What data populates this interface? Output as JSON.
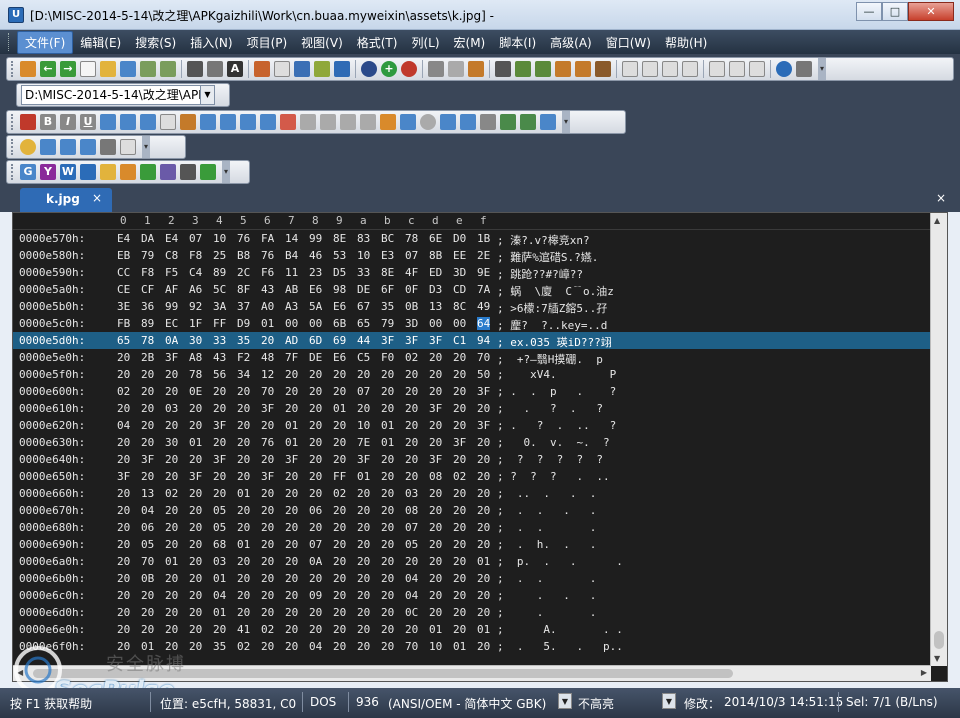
{
  "titlebar": {
    "title": "[D:\\MISC-2014-5-14\\改之理\\APKgaizhili\\Work\\cn.buaa.myweixin\\assets\\k.jpg] -",
    "minimize": "—",
    "maximize": "□",
    "close": "✕"
  },
  "menu": [
    "文件(F)",
    "编辑(E)",
    "搜索(S)",
    "插入(N)",
    "项目(P)",
    "视图(V)",
    "格式(T)",
    "列(L)",
    "宏(M)",
    "脚本(I)",
    "高级(A)",
    "窗口(W)",
    "帮助(H)"
  ],
  "path_combo": "D:\\MISC-2014-5-14\\改之理\\APK",
  "tab": {
    "label": "k.jpg",
    "close": "×"
  },
  "ruler": [
    "0",
    "1",
    "2",
    "3",
    "4",
    "5",
    "6",
    "7",
    "8",
    "9",
    "a",
    "b",
    "c",
    "d",
    "e",
    "f"
  ],
  "rows": [
    {
      "addr": "0000e570h:",
      "hex": [
        "E4",
        "DA",
        "E4",
        "07",
        "10",
        "76",
        "FA",
        "14",
        "99",
        "8E",
        "83",
        "BC",
        "78",
        "6E",
        "D0",
        "1B"
      ],
      "ascii": "; 溱?.v?槔竞xn?"
    },
    {
      "addr": "0000e580h:",
      "hex": [
        "EB",
        "79",
        "C8",
        "F8",
        "25",
        "B8",
        "76",
        "B4",
        "46",
        "53",
        "10",
        "E3",
        "07",
        "8B",
        "EE",
        "2E"
      ],
      "ascii": "; 難萨%逭碏S.?嬿."
    },
    {
      "addr": "0000e590h:",
      "hex": [
        "CC",
        "F8",
        "F5",
        "C4",
        "89",
        "2C",
        "F6",
        "11",
        "23",
        "D5",
        "33",
        "8E",
        "4F",
        "ED",
        "3D",
        "9E"
      ],
      "ascii": "; 跳跄??#?嶂??"
    },
    {
      "addr": "0000e5a0h:",
      "hex": [
        "CE",
        "CF",
        "AF",
        "A6",
        "5C",
        "8F",
        "43",
        "AB",
        "E6",
        "98",
        "DE",
        "6F",
        "0F",
        "D3",
        "CD",
        "7A"
      ],
      "ascii": "; 蜗  \\廈  C﹊o.油z"
    },
    {
      "addr": "0000e5b0h:",
      "hex": [
        "3E",
        "36",
        "99",
        "92",
        "3A",
        "37",
        "A0",
        "A3",
        "5A",
        "E6",
        "67",
        "35",
        "0B",
        "13",
        "8C",
        "49"
      ],
      "ascii": "; >6檬:7牐Z鎔5..孖"
    },
    {
      "addr": "0000e5c0h:",
      "hex": [
        "FB",
        "89",
        "EC",
        "1F",
        "FF",
        "D9",
        "01",
        "00",
        "00",
        "6B",
        "65",
        "79",
        "3D",
        "00",
        "00",
        "64"
      ],
      "ascii": "; 麈?  ?..key=..d"
    },
    {
      "addr": "0000e5d0h:",
      "hex": [
        "65",
        "78",
        "0A",
        "30",
        "33",
        "35",
        "20",
        "AD",
        "6D",
        "69",
        "44",
        "3F",
        "3F",
        "3F",
        "C1",
        "94"
      ],
      "ascii": "; ex.035 瑛iD???翊"
    },
    {
      "addr": "0000e5e0h:",
      "hex": [
        "20",
        "2B",
        "3F",
        "A8",
        "43",
        "F2",
        "48",
        "7F",
        "DE",
        "E6",
        "C5",
        "F0",
        "02",
        "20",
        "20",
        "70"
      ],
      "ascii": ";  +?―翳H摸硼.  p"
    },
    {
      "addr": "0000e5f0h:",
      "hex": [
        "20",
        "20",
        "20",
        "78",
        "56",
        "34",
        "12",
        "20",
        "20",
        "20",
        "20",
        "20",
        "20",
        "20",
        "20",
        "50"
      ],
      "ascii": ";    xV4.        P"
    },
    {
      "addr": "0000e600h:",
      "hex": [
        "02",
        "20",
        "20",
        "0E",
        "20",
        "20",
        "70",
        "20",
        "20",
        "20",
        "07",
        "20",
        "20",
        "20",
        "20",
        "3F"
      ],
      "ascii": "; .  .  p   .    ?"
    },
    {
      "addr": "0000e610h:",
      "hex": [
        "20",
        "20",
        "03",
        "20",
        "20",
        "20",
        "3F",
        "20",
        "20",
        "01",
        "20",
        "20",
        "20",
        "3F",
        "20",
        "20"
      ],
      "ascii": ";   .   ?  .   ?"
    },
    {
      "addr": "0000e620h:",
      "hex": [
        "04",
        "20",
        "20",
        "20",
        "3F",
        "20",
        "20",
        "01",
        "20",
        "20",
        "10",
        "01",
        "20",
        "20",
        "20",
        "3F"
      ],
      "ascii": "; .   ?  .  ..   ?"
    },
    {
      "addr": "0000e630h:",
      "hex": [
        "20",
        "20",
        "30",
        "01",
        "20",
        "20",
        "76",
        "01",
        "20",
        "20",
        "7E",
        "01",
        "20",
        "20",
        "3F",
        "20"
      ],
      "ascii": ";   0.  v.  ~.  ?"
    },
    {
      "addr": "0000e640h:",
      "hex": [
        "20",
        "3F",
        "20",
        "20",
        "3F",
        "20",
        "20",
        "3F",
        "20",
        "20",
        "3F",
        "20",
        "20",
        "3F",
        "20",
        "20"
      ],
      "ascii": ";  ?  ?  ?  ?  ?"
    },
    {
      "addr": "0000e650h:",
      "hex": [
        "3F",
        "20",
        "20",
        "3F",
        "20",
        "20",
        "3F",
        "20",
        "20",
        "FF",
        "01",
        "20",
        "20",
        "08",
        "02",
        "20"
      ],
      "ascii": "; ?  ?  ?   .  .."
    },
    {
      "addr": "0000e660h:",
      "hex": [
        "20",
        "13",
        "02",
        "20",
        "20",
        "01",
        "20",
        "20",
        "20",
        "02",
        "20",
        "20",
        "03",
        "20",
        "20",
        "20"
      ],
      "ascii": ";  ..  .   .  ."
    },
    {
      "addr": "0000e670h:",
      "hex": [
        "20",
        "04",
        "20",
        "20",
        "05",
        "20",
        "20",
        "20",
        "06",
        "20",
        "20",
        "20",
        "08",
        "20",
        "20",
        "20"
      ],
      "ascii": ";  .  .   .   ."
    },
    {
      "addr": "0000e680h:",
      "hex": [
        "20",
        "06",
        "20",
        "20",
        "05",
        "20",
        "20",
        "20",
        "20",
        "20",
        "20",
        "20",
        "07",
        "20",
        "20",
        "20"
      ],
      "ascii": ";  .  .       ."
    },
    {
      "addr": "0000e690h:",
      "hex": [
        "20",
        "05",
        "20",
        "20",
        "68",
        "01",
        "20",
        "20",
        "07",
        "20",
        "20",
        "20",
        "05",
        "20",
        "20",
        "20"
      ],
      "ascii": ";  .  h.  .   ."
    },
    {
      "addr": "0000e6a0h:",
      "hex": [
        "20",
        "70",
        "01",
        "20",
        "03",
        "20",
        "20",
        "20",
        "0A",
        "20",
        "20",
        "20",
        "20",
        "20",
        "20",
        "01"
      ],
      "ascii": ";  p.  .   .      ."
    },
    {
      "addr": "0000e6b0h:",
      "hex": [
        "20",
        "0B",
        "20",
        "20",
        "01",
        "20",
        "20",
        "20",
        "20",
        "20",
        "20",
        "20",
        "04",
        "20",
        "20",
        "20"
      ],
      "ascii": ";  .  .       ."
    },
    {
      "addr": "0000e6c0h:",
      "hex": [
        "20",
        "20",
        "20",
        "20",
        "04",
        "20",
        "20",
        "20",
        "09",
        "20",
        "20",
        "20",
        "04",
        "20",
        "20",
        "20"
      ],
      "ascii": ";     .   .   ."
    },
    {
      "addr": "0000e6d0h:",
      "hex": [
        "20",
        "20",
        "20",
        "20",
        "01",
        "20",
        "20",
        "20",
        "20",
        "20",
        "20",
        "20",
        "0C",
        "20",
        "20",
        "20"
      ],
      "ascii": ";     .       ."
    },
    {
      "addr": "0000e6e0h:",
      "hex": [
        "20",
        "20",
        "20",
        "20",
        "20",
        "41",
        "02",
        "20",
        "20",
        "20",
        "20",
        "20",
        "20",
        "01",
        "20",
        "01"
      ],
      "ascii": ";      A.       . ."
    },
    {
      "addr": "0000e6f0h:",
      "hex": [
        "20",
        "01",
        "20",
        "20",
        "35",
        "02",
        "20",
        "20",
        "04",
        "20",
        "20",
        "20",
        "70",
        "10",
        "01",
        "20"
      ],
      "ascii": ";  .   5.   .   p.."
    }
  ],
  "status": {
    "help": "按 F1 获取帮助",
    "position": "位置: e5cfH, 58831, C0",
    "line_ending": "DOS",
    "codepage": "936",
    "encoding": "(ANSI/OEM - 简体中文 GBK)",
    "highlight": "不高亮",
    "modified": "修改：",
    "timestamp": "2014/10/3 14:51:15",
    "selection": "Sel: 7/1 (B/Lns)"
  },
  "watermark": {
    "cn": "安全脉搏",
    "en": "SecPulse"
  },
  "colors": {
    "editor_bg": "#1e1e1e",
    "highlight_row": "#1e5f86",
    "selection": "#2a7ccc",
    "tab": "#2f6bb5",
    "menubar": "#2f3d50"
  }
}
